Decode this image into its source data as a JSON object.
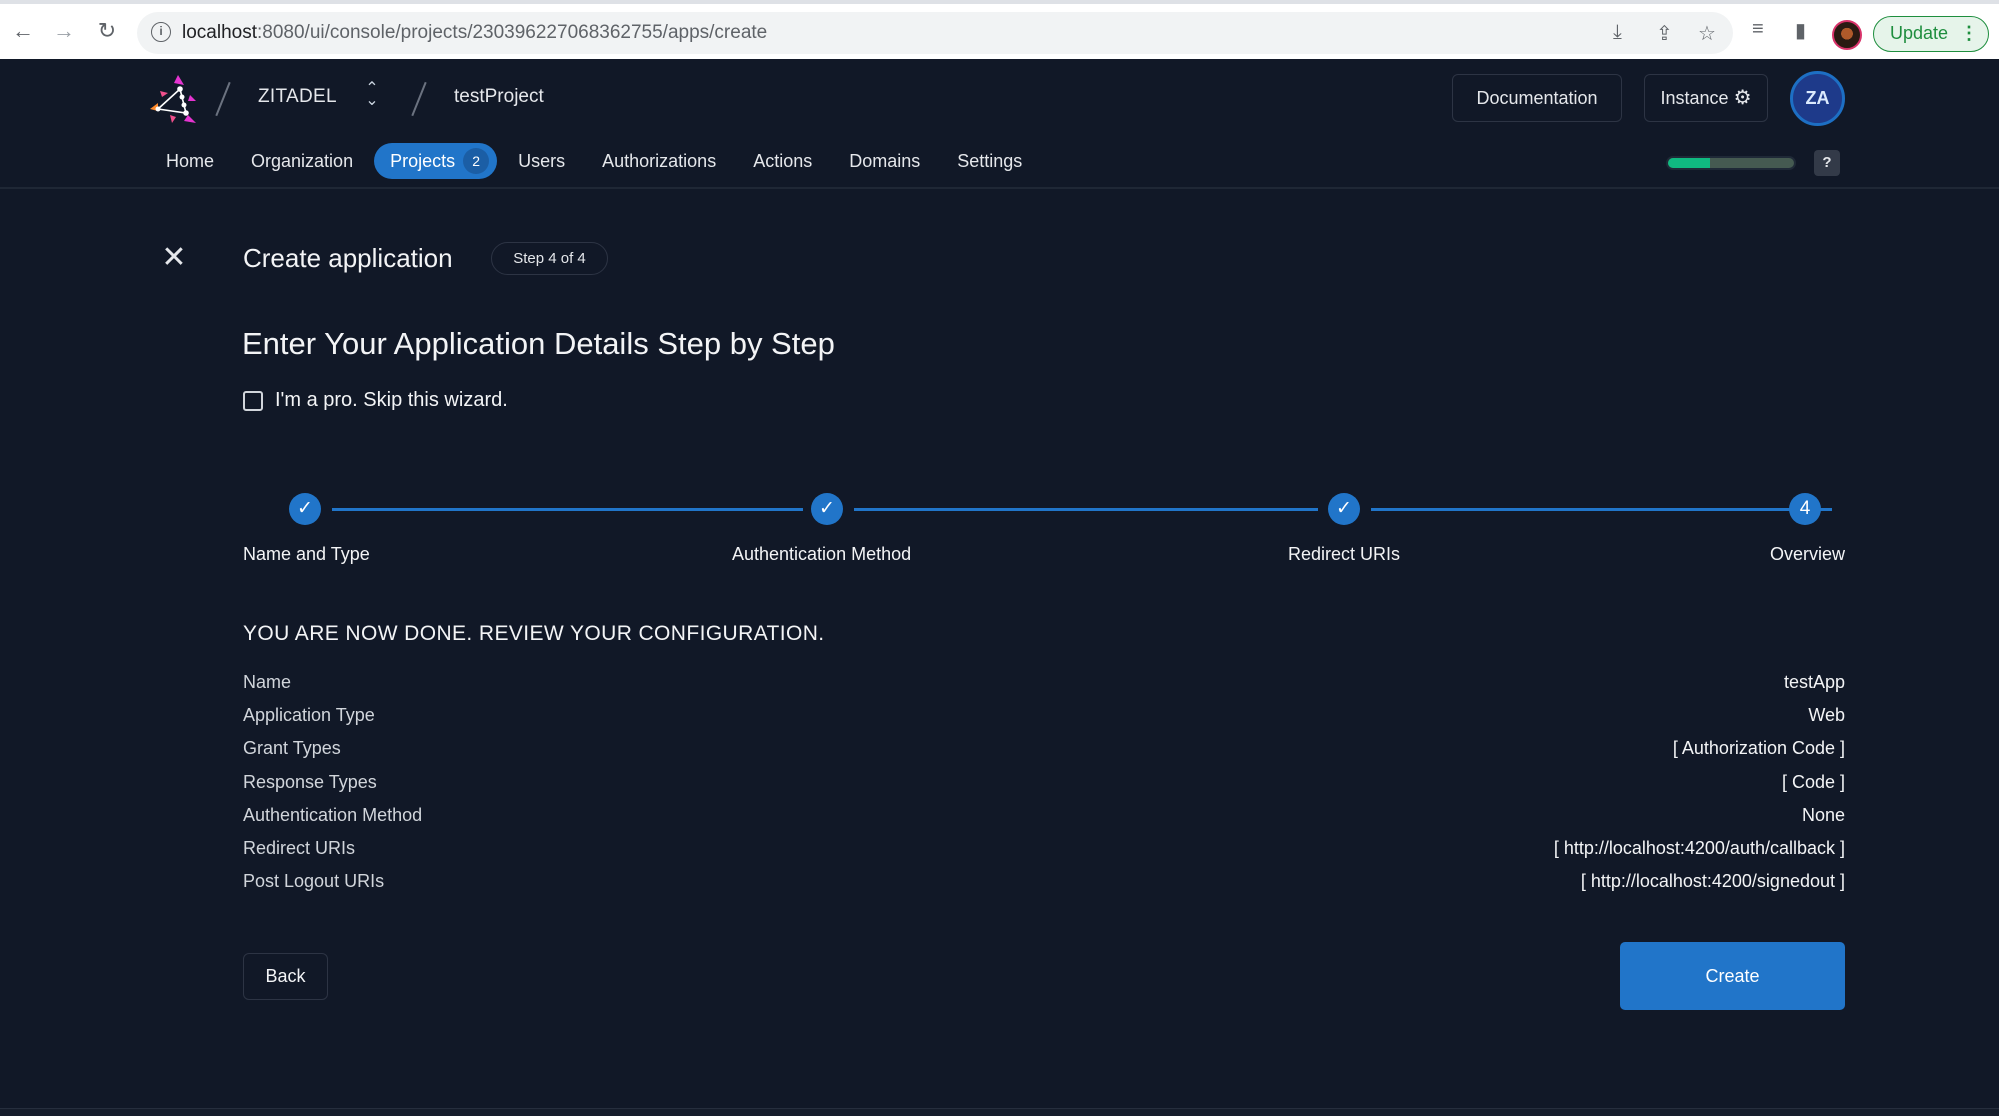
{
  "browser": {
    "url_host": "localhost",
    "url_rest": ":8080/ui/console/projects/230396227068362755/apps/create",
    "update_label": "Update",
    "icons": [
      "back-icon",
      "forward-icon",
      "reload-icon",
      "info-icon",
      "install-icon",
      "share-icon",
      "bookmark-star-icon",
      "media-icon",
      "sidebar-icon",
      "profile-avatar",
      "menu-dots-icon"
    ]
  },
  "header": {
    "org_name": "ZITADEL",
    "project_name": "testProject",
    "documentation_label": "Documentation",
    "instance_label": "Instance",
    "avatar_initials": "ZA",
    "help_label": "?",
    "progress_fraction": 0.33
  },
  "nav": {
    "items": [
      {
        "label": "Home"
      },
      {
        "label": "Organization"
      },
      {
        "label": "Projects",
        "badge": "2",
        "active": true
      },
      {
        "label": "Users"
      },
      {
        "label": "Authorizations"
      },
      {
        "label": "Actions"
      },
      {
        "label": "Domains"
      },
      {
        "label": "Settings"
      }
    ]
  },
  "page": {
    "title": "Create application",
    "step_chip": "Step 4 of 4",
    "heading": "Enter Your Application Details Step by Step",
    "skip_wizard_label": "I'm a pro. Skip this wizard.",
    "skip_wizard_checked": false
  },
  "stepper": {
    "steps": [
      {
        "label": "Name and Type",
        "state": "done",
        "marker": "✓"
      },
      {
        "label": "Authentication Method",
        "state": "done",
        "marker": "✓"
      },
      {
        "label": "Redirect URIs",
        "state": "done",
        "marker": "✓"
      },
      {
        "label": "Overview",
        "state": "active",
        "marker": "4"
      }
    ]
  },
  "review": {
    "heading": "YOU ARE NOW DONE. REVIEW YOUR CONFIGURATION.",
    "rows": [
      {
        "key": "Name",
        "value": "testApp"
      },
      {
        "key": "Application Type",
        "value": "Web"
      },
      {
        "key": "Grant Types",
        "value": "[ Authorization Code ]"
      },
      {
        "key": "Response Types",
        "value": "[ Code ]"
      },
      {
        "key": "Authentication Method",
        "value": "None"
      },
      {
        "key": "Redirect URIs",
        "value": "[ http://localhost:4200/auth/callback ]"
      },
      {
        "key": "Post Logout URIs",
        "value": "[ http://localhost:4200/signedout ]"
      }
    ]
  },
  "actions": {
    "back_label": "Back",
    "create_label": "Create"
  },
  "colors": {
    "background": "#111827",
    "accent": "#2175c9",
    "progress": "#10b981"
  }
}
